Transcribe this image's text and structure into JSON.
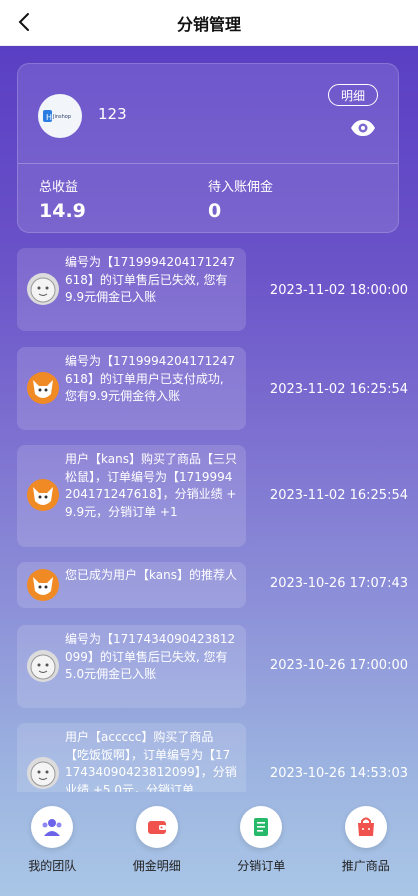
{
  "header": {
    "title": "分销管理",
    "back_icon": "chevron-left-icon"
  },
  "summary": {
    "username": "123",
    "logo_text": "Jinshop",
    "detail_label": "明细",
    "eye_icon": "eye-icon",
    "total_income_label": "总收益",
    "total_income_value": "14.9",
    "pending_label": "待入账佣金",
    "pending_value": "0"
  },
  "feed": [
    {
      "avatar": "moon",
      "message": "编号为【1719994204171247618】的订单售后已失效, 您有9.9元佣金已入账",
      "time": "2023-11-02 18:00:00"
    },
    {
      "avatar": "fox",
      "message": "编号为【1719994204171247618】的订单用户已支付成功, 您有9.9元佣金待入账",
      "time": "2023-11-02 16:25:54"
    },
    {
      "avatar": "fox",
      "message": "用户【kans】购买了商品【三只松鼠】，订单编号为【1719994204171247618】，分销业绩 +9.9元，分销订单 +1",
      "time": "2023-11-02 16:25:54"
    },
    {
      "avatar": "fox",
      "message": "您已成为用户【kans】的推荐人",
      "time": "2023-10-26 17:07:43"
    },
    {
      "avatar": "moon",
      "message": "编号为【1717434090423812099】的订单售后已失效, 您有5.0元佣金已入账",
      "time": "2023-10-26 17:00:00"
    },
    {
      "avatar": "moon",
      "message": "用户【accccc】购买了商品【吃饭饭啊】，订单编号为【1717434090423812099】，分销业绩 +5.0元，分销订单",
      "time": "2023-10-26 14:53:03"
    }
  ],
  "nav": [
    {
      "label": "我的团队",
      "icon": "team-icon",
      "color": "#6c63e8"
    },
    {
      "label": "佣金明细",
      "icon": "wallet-icon",
      "color": "#f0524d"
    },
    {
      "label": "分销订单",
      "icon": "order-list-icon",
      "color": "#27b96a"
    },
    {
      "label": "推广商品",
      "icon": "shopping-bag-icon",
      "color": "#f0524d"
    }
  ]
}
